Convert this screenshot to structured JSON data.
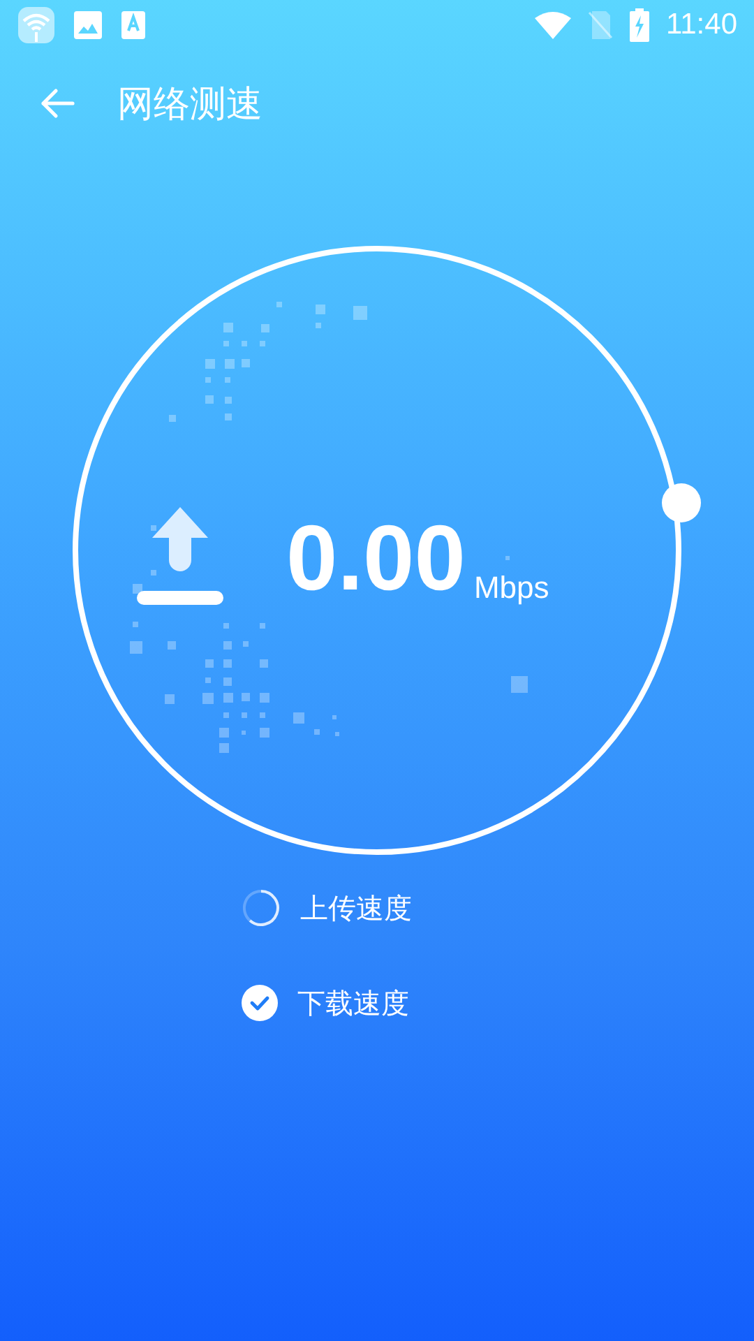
{
  "status_bar": {
    "time": "11:40"
  },
  "header": {
    "title": "网络测速"
  },
  "gauge": {
    "value": "0.00",
    "unit": "Mbps"
  },
  "steps": [
    {
      "label": "上传速度",
      "checked": false
    },
    {
      "label": "下载速度",
      "checked": true
    }
  ]
}
